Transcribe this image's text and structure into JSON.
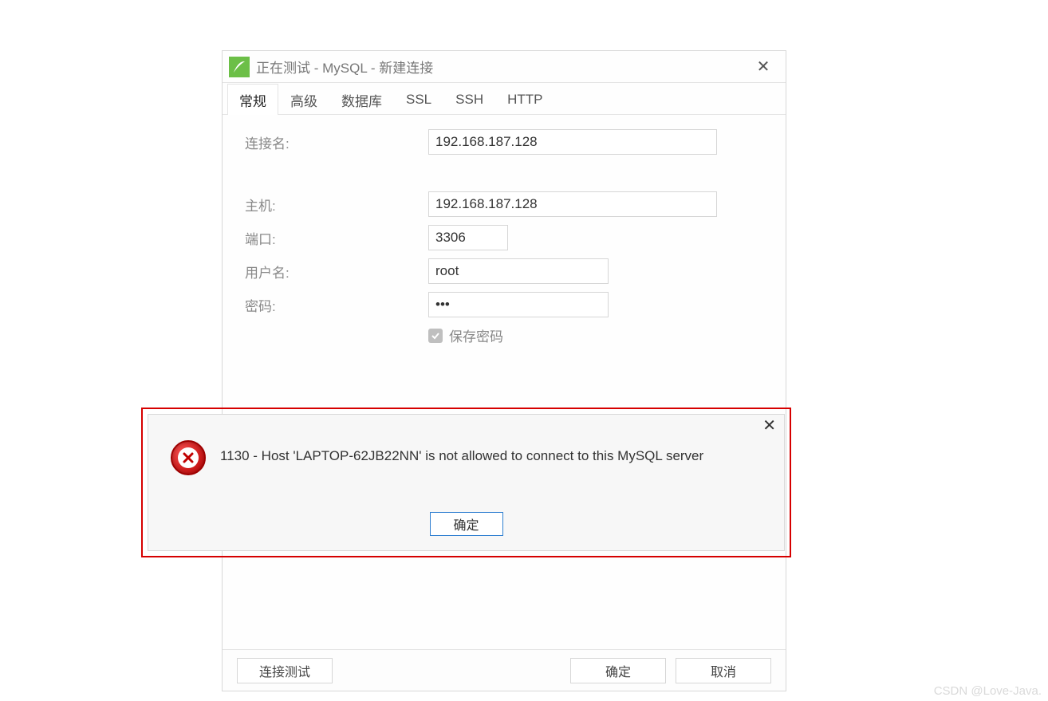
{
  "window": {
    "title": "正在测试 - MySQL - 新建连接"
  },
  "tabs": [
    {
      "label": "常规"
    },
    {
      "label": "高级"
    },
    {
      "label": "数据库"
    },
    {
      "label": "SSL"
    },
    {
      "label": "SSH"
    },
    {
      "label": "HTTP"
    }
  ],
  "form": {
    "connection_name_label": "连接名:",
    "connection_name_value": "192.168.187.128",
    "host_label": "主机:",
    "host_value": "192.168.187.128",
    "port_label": "端口:",
    "port_value": "3306",
    "user_label": "用户名:",
    "user_value": "root",
    "password_label": "密码:",
    "password_value": "•••",
    "save_password_label": "保存密码"
  },
  "footer": {
    "test_label": "连接测试",
    "ok_label": "确定",
    "cancel_label": "取消"
  },
  "error": {
    "message": "1130 - Host 'LAPTOP-62JB22NN' is not allowed to connect to this MySQL server",
    "ok_label": "确定"
  },
  "watermark": "CSDN @Love-Java."
}
